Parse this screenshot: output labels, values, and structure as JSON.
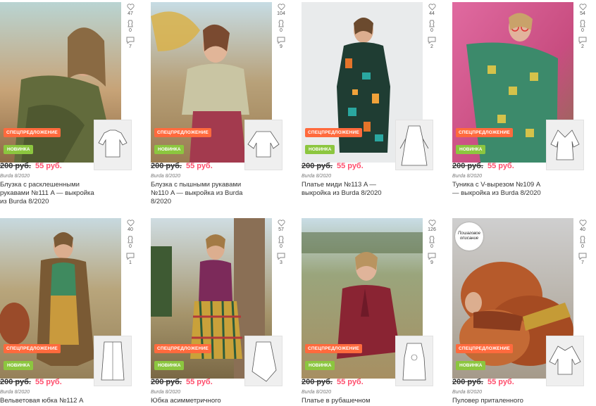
{
  "cards": [
    {
      "likes": "47",
      "saves": "0",
      "comments": "7",
      "offer": "СПЕЦПРЕДЛОЖЕНИЕ",
      "new": "НОВИНКА",
      "old_price": "200 руб.",
      "new_price": "55 руб.",
      "source": "Burda 8/2020",
      "title": "Блузка с расклешенными рукавами №111 A — выкройка из Burda 8/2020"
    },
    {
      "likes": "104",
      "saves": "0",
      "comments": "9",
      "offer": "СПЕЦПРЕДЛОЖЕНИЕ",
      "new": "НОВИНКА",
      "old_price": "200 руб.",
      "new_price": "55 руб.",
      "source": "Burda 8/2020",
      "title": "Блузка с пышными рукавами №110 A — выкройка из Burda 8/2020"
    },
    {
      "likes": "44",
      "saves": "0",
      "comments": "2",
      "offer": "СПЕЦПРЕДЛОЖЕНИЕ",
      "new": "НОВИНКА",
      "old_price": "200 руб.",
      "new_price": "55 руб.",
      "source": "Burda 8/2020",
      "title": "Платье миди №113 A — выкройка из Burda 8/2020"
    },
    {
      "likes": "54",
      "saves": "0",
      "comments": "2",
      "offer": "СПЕЦПРЕДЛОЖЕНИЕ",
      "new": "НОВИНКА",
      "old_price": "200 руб.",
      "new_price": "55 руб.",
      "source": "Burda 8/2020",
      "title": "Туника с V-вырезом №109 A — выкройка из Burda 8/2020"
    },
    {
      "likes": "40",
      "saves": "0",
      "comments": "1",
      "offer": "СПЕЦПРЕДЛОЖЕНИЕ",
      "new": "НОВИНКА",
      "old_price": "200 руб.",
      "new_price": "55 руб.",
      "source": "Burda 8/2020",
      "title": "Вельветовая юбка №112 A"
    },
    {
      "likes": "57",
      "saves": "0",
      "comments": "3",
      "offer": "СПЕЦПРЕДЛОЖЕНИЕ",
      "new": "НОВИНКА",
      "old_price": "200 руб.",
      "new_price": "55 руб.",
      "source": "Burda 8/2020",
      "title": "Юбка асимметричного"
    },
    {
      "likes": "126",
      "saves": "0",
      "comments": "9",
      "offer": "СПЕЦПРЕДЛОЖЕНИЕ",
      "new": "НОВИНКА",
      "old_price": "200 руб.",
      "new_price": "55 руб.",
      "source": "Burda 8/2020",
      "title": "Платье в рубашечном"
    },
    {
      "likes": "40",
      "saves": "0",
      "comments": "7",
      "offer": "СПЕЦПРЕДЛОЖЕНИЕ",
      "new": "НОВИНКА",
      "old_price": "200 руб.",
      "new_price": "55 руб.",
      "source": "Burda 8/2020",
      "title": "Пуловер приталенного",
      "step_badge": "Пошаговое описание"
    }
  ]
}
